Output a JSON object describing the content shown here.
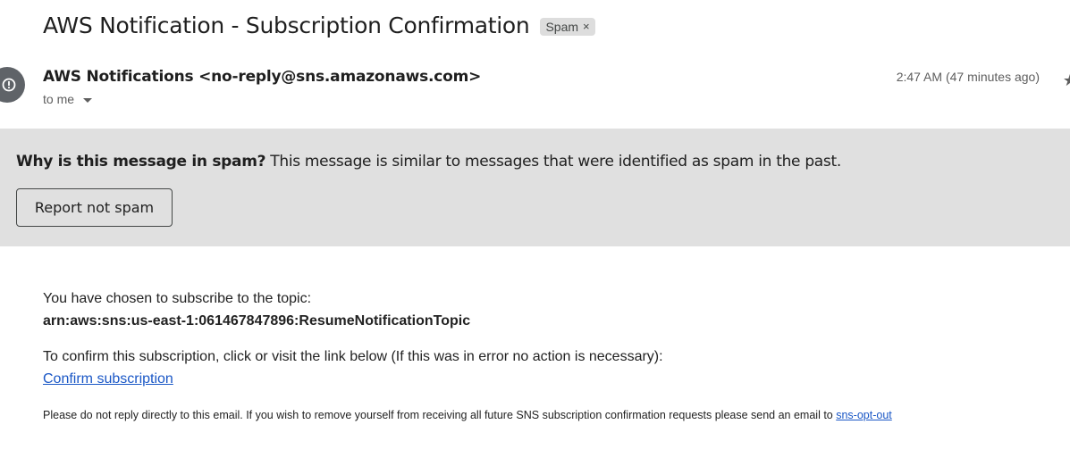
{
  "email": {
    "subject": "AWS Notification - Subscription Confirmation",
    "label": {
      "text": "Spam",
      "remove_glyph": "×"
    },
    "sender": "AWS Notifications <no-reply@sns.amazonaws.com>",
    "recipient": "to me",
    "timestamp": "2:47 AM (47 minutes ago)",
    "avatar_icon": "alert-circle-icon",
    "star_icon": "star-icon"
  },
  "spam_banner": {
    "heading": "Why is this message in spam?",
    "explanation": " This message is similar to messages that were identified as spam in the past.",
    "button_label": "Report not spam"
  },
  "body": {
    "line1": "You have chosen to subscribe to the topic:",
    "topic_arn": "arn:aws:sns:us-east-1:061467847896:ResumeNotificationTopic",
    "line2": "To confirm this subscription, click or visit the link below (If this was in error no action is necessary):",
    "confirm_link": "Confirm subscription",
    "footer_text": "Please do not reply directly to this email. If you wish to remove yourself from receiving all future SNS subscription confirmation requests please send an email to ",
    "opt_out_link": "sns-opt-out"
  }
}
